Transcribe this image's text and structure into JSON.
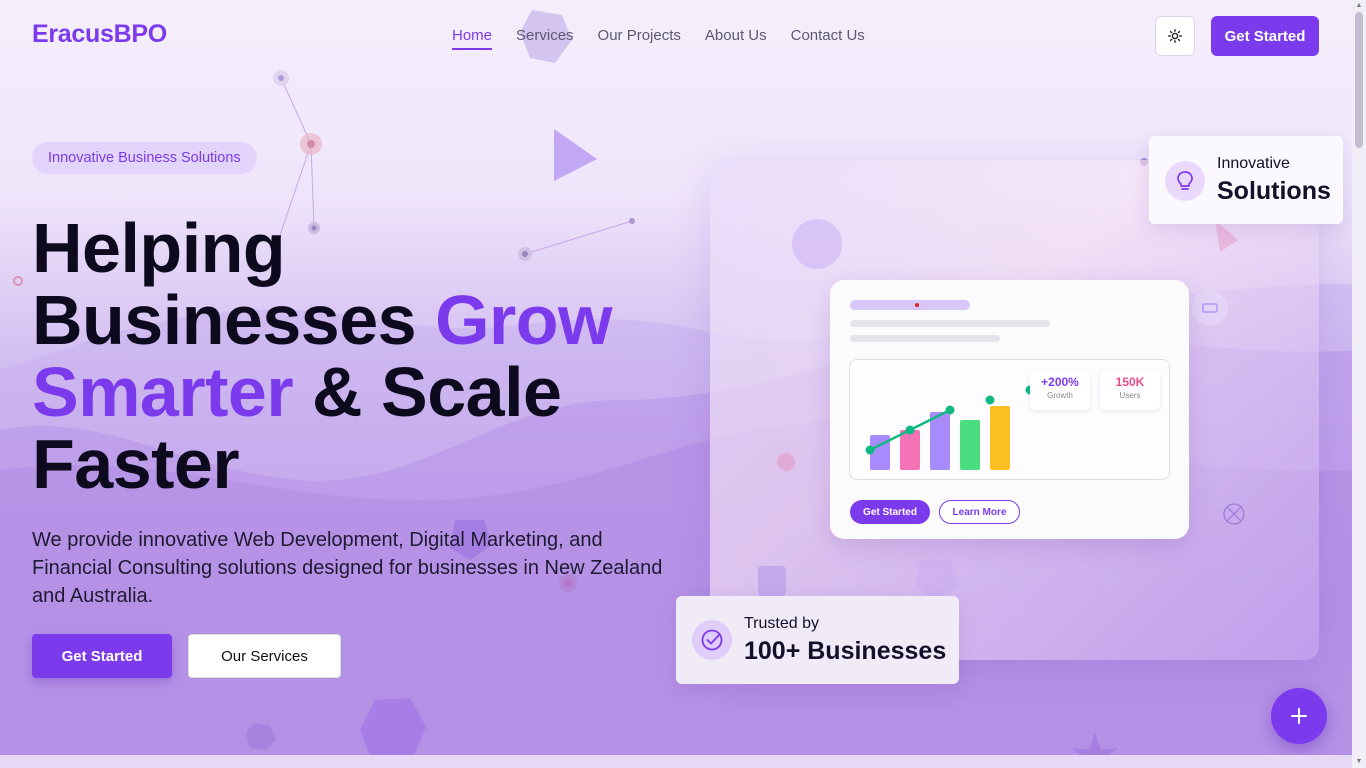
{
  "brand": {
    "name": "EracusBPO",
    "accent": "#7c3aed"
  },
  "nav": {
    "items": [
      {
        "label": "Home",
        "active": true
      },
      {
        "label": "Services",
        "active": false
      },
      {
        "label": "Our Projects",
        "active": false
      },
      {
        "label": "About Us",
        "active": false
      },
      {
        "label": "Contact Us",
        "active": false
      }
    ],
    "theme_toggle_icon": "sun-icon",
    "cta": "Get Started"
  },
  "hero": {
    "badge": "Innovative Business Solutions",
    "headline_1": "Helping",
    "headline_2": "Businesses ",
    "headline_highlight_1": "Grow",
    "headline_highlight_2": "Smarter",
    "headline_3": " & Scale",
    "headline_4": "Faster",
    "subtext": "We provide innovative Web Development, Digital Marketing, and Financial Consulting solutions designed for businesses in New Zealand and Australia.",
    "primary_button": "Get Started",
    "secondary_button": "Our Services"
  },
  "dashboard": {
    "stat_growth_value": "+200%",
    "stat_growth_label": "Growth",
    "stat_users_value": "150K",
    "stat_users_label": "Users",
    "button_primary": "Get Started",
    "button_secondary": "Learn More",
    "bar_colors": [
      "#a78bfa",
      "#f472b6",
      "#a78bfa",
      "#4ade80",
      "#fbbf24"
    ],
    "line_color": "#10b981"
  },
  "float_top": {
    "icon": "lightbulb-icon",
    "line1": "Innovative",
    "line2": "Solutions"
  },
  "float_bottom": {
    "icon": "check-badge-icon",
    "line1": "Trusted by",
    "line2": "100+ Businesses"
  },
  "fab_icon": "plus-icon"
}
